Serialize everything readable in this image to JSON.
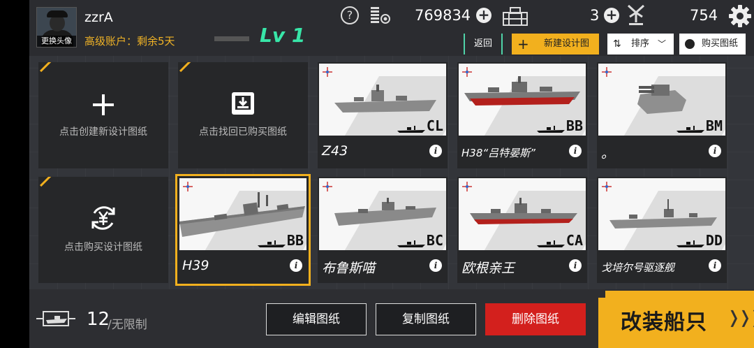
{
  "profile": {
    "username": "zzrA",
    "change_avatar": "更换头像",
    "account_status": "高级账户：剩余5天",
    "level": "Lv 1"
  },
  "currencies": {
    "coins": "769834",
    "tokens": "3",
    "points": "754"
  },
  "actions": {
    "back": "返回",
    "new_design": "新建设计图",
    "sort": "排序",
    "buy_design": "购买图纸"
  },
  "action_cards": {
    "create": "点击创建新设计图纸",
    "retrieve": "点击找回已购买图纸",
    "purchase": "点击购买设计图纸"
  },
  "designs": [
    {
      "name": "Z43",
      "class": "CL"
    },
    {
      "name": "H38“吕特晏斯”",
      "class": "BB"
    },
    {
      "name": "。",
      "class": "BM"
    },
    {
      "name": "H39",
      "class": "BB"
    },
    {
      "name": "布鲁斯喵",
      "class": "BC"
    },
    {
      "name": "欧根亲王",
      "class": "CA"
    },
    {
      "name": "戈培尔号驱逐舰",
      "class": "DD"
    }
  ],
  "bottom": {
    "count": "12",
    "limit": "/无限制",
    "edit": "编辑图纸",
    "copy": "复制图纸",
    "delete": "删除图纸",
    "modify": "改装船只"
  },
  "colors": {
    "accent": "#f2b01e",
    "level": "#38e6a8",
    "danger": "#d3201d",
    "hull_red": "#b3201c"
  }
}
